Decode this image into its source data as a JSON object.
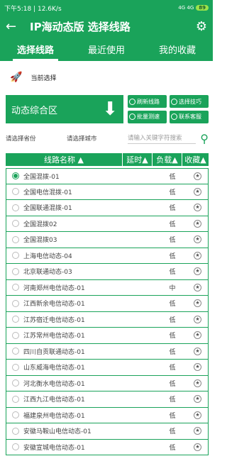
{
  "status_bar": {
    "time_speed": "下午5:18 | 12.6K/s",
    "signal": "4G 4G",
    "battery": "89"
  },
  "app_bar": {
    "title": "IP海动态版 选择线路"
  },
  "tabs": [
    {
      "label": "选择线路",
      "active": true
    },
    {
      "label": "最近使用",
      "active": false
    },
    {
      "label": "我的收藏",
      "active": false
    }
  ],
  "current": {
    "label": "当前选择"
  },
  "region": {
    "label": "动态综合区"
  },
  "tools": [
    {
      "label": "刷新线路"
    },
    {
      "label": "选择技巧"
    },
    {
      "label": "批量测速"
    },
    {
      "label": "联系客服"
    }
  ],
  "filters": {
    "province": "请选择省份",
    "city": "请选择城市",
    "search_placeholder": "请输入关键字符搜索"
  },
  "table": {
    "headers": {
      "name": "线路名称 ▲",
      "latency": "延时▲",
      "load": "负载▲",
      "favorite": "收藏▲"
    },
    "rows": [
      {
        "name": "全国混拨-01",
        "load": "低",
        "selected": true
      },
      {
        "name": "全国电信混拨-01",
        "load": "低"
      },
      {
        "name": "全国联通混拨-01",
        "load": "低"
      },
      {
        "name": "全国混拨02",
        "load": "低"
      },
      {
        "name": "全国混拨03",
        "load": "低"
      },
      {
        "name": "上海电信动态-04",
        "load": "低"
      },
      {
        "name": "北京联通动态-03",
        "load": "低"
      },
      {
        "name": "河南郑州电信动态-01",
        "load": "中"
      },
      {
        "name": "江西新余电信动态-01",
        "load": "低"
      },
      {
        "name": "江苏宿迁电信动态-01",
        "load": "低"
      },
      {
        "name": "江苏常州电信动态-01",
        "load": "低"
      },
      {
        "name": "四川自贡联通动态-01",
        "load": "低"
      },
      {
        "name": "山东威海电信动态-01",
        "load": "低"
      },
      {
        "name": "河北衡水电信动态-01",
        "load": "低"
      },
      {
        "name": "江西九江电信动态-01",
        "load": "低"
      },
      {
        "name": "福建泉州电信动态-01",
        "load": "低"
      },
      {
        "name": "安徽马鞍山电信动态-01",
        "load": "低"
      },
      {
        "name": "安徽宣城电信动态-01",
        "load": "低"
      }
    ]
  }
}
